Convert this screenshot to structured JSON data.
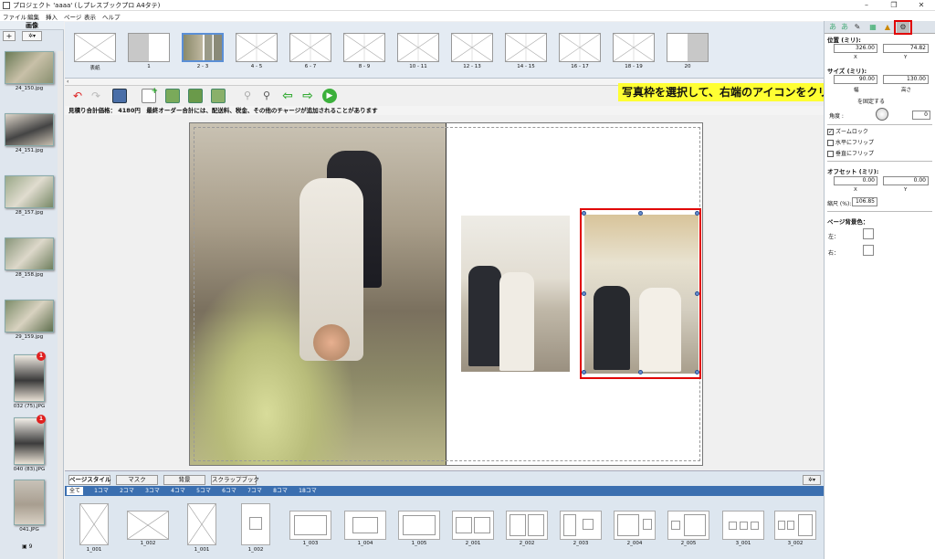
{
  "window": {
    "title": "プロジェクト 'aaaa' (しプレスブックプロ A4タテ)"
  },
  "menu": [
    "ファイル",
    "編集",
    "挿入",
    "ページ",
    "表示",
    "ヘルプ"
  ],
  "left_panel": {
    "title": "画像",
    "add_label": "+",
    "settings_label": "✲▾",
    "images": [
      {
        "label": "24_150.jpg",
        "badge": ""
      },
      {
        "label": "24_151.jpg",
        "badge": ""
      },
      {
        "label": "28_157.jpg",
        "badge": ""
      },
      {
        "label": "28_158.jpg",
        "badge": ""
      },
      {
        "label": "29_159.jpg",
        "badge": ""
      },
      {
        "label": "032 (75).JPG",
        "badge": "1"
      },
      {
        "label": "040 (83).JPG",
        "badge": "1"
      },
      {
        "label": "041.JPG",
        "badge": ""
      }
    ],
    "count": "9"
  },
  "page_strip": [
    "表紙",
    "1",
    "2 - 3",
    "4 - 5",
    "6 - 7",
    "8 - 9",
    "10 - 11",
    "12 - 13",
    "14 - 15",
    "16 - 17",
    "18 - 19",
    "20"
  ],
  "price_bar": "見積り合計価格： 4180円　最終オーダー合計には、配送料、税金、その他のチャージが追加されることがあります",
  "tooltip": "写真枠を選択して、右端のアイコンをクリック",
  "bottom_tabs": [
    "ページスタイル",
    "マスク",
    "背景",
    "スクラップブック"
  ],
  "bottom_subtabs": [
    "全て",
    "1コマ",
    "2コマ",
    "3コマ",
    "4コマ",
    "5コマ",
    "6コマ",
    "7コマ",
    "8コマ",
    "18コマ"
  ],
  "layouts": [
    "1_001",
    "1_002",
    "1_001",
    "1_002",
    "1_003",
    "1_004",
    "1_005",
    "2_001",
    "2_002",
    "2_003",
    "2_004",
    "2_005",
    "3_001",
    "3_002"
  ],
  "right_panel": {
    "tabs": [
      "あ",
      "あ",
      "✎",
      "▦",
      "▲",
      "⚙"
    ],
    "position_label": "位置 (ミリ):",
    "position_x": "326.00",
    "position_y": "74.82",
    "x_label": "X",
    "y_label": "Y",
    "size_label": "サイズ (ミリ):",
    "size_w": "90.00",
    "size_h": "130.00",
    "width_label": "幅",
    "height_label": "高さ",
    "fix_ratio": "を固定する",
    "angle_label": "角度 :",
    "angle_value": "0",
    "zoom_lock": "ズームロック",
    "flip_h": "水平にフリップ",
    "flip_v": "垂直にフリップ",
    "offset_label": "オフセット (ミリ):",
    "offset_x": "0.00",
    "offset_y": "0.00",
    "scale_label": "縮尺 (%):",
    "scale_value": "106.85",
    "bg_label": "ページ背景色：",
    "left_label": "左：",
    "right_label": "右："
  }
}
